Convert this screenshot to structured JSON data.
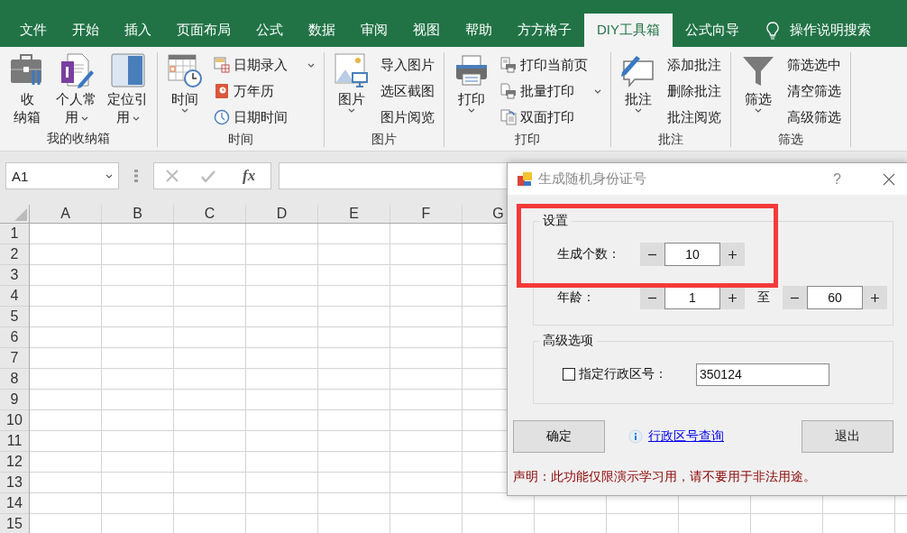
{
  "tabs": [
    {
      "label": "文件",
      "selected": false
    },
    {
      "label": "开始",
      "selected": false
    },
    {
      "label": "插入",
      "selected": false
    },
    {
      "label": "页面布局",
      "selected": false
    },
    {
      "label": "公式",
      "selected": false
    },
    {
      "label": "数据",
      "selected": false
    },
    {
      "label": "审阅",
      "selected": false
    },
    {
      "label": "视图",
      "selected": false
    },
    {
      "label": "帮助",
      "selected": false
    },
    {
      "label": "方方格子",
      "selected": false
    },
    {
      "label": "DIY工具箱",
      "selected": true
    },
    {
      "label": "公式向导",
      "selected": false
    }
  ],
  "search": {
    "label": "操作说明搜索"
  },
  "ribbon": {
    "groups": [
      {
        "label": "我的收纳箱",
        "large": [
          {
            "lines": [
              "收",
              "纳箱"
            ],
            "dropdown": false
          },
          {
            "lines": [
              "个人常",
              "用"
            ],
            "dropdown": true
          },
          {
            "lines": [
              "定位引",
              "用"
            ],
            "dropdown": true
          }
        ]
      },
      {
        "label": "时间",
        "large": [
          {
            "lines": [
              "时间"
            ],
            "dropdown": true
          }
        ],
        "small": [
          {
            "label": "日期录入",
            "dropdown": true
          },
          {
            "label": "万年历",
            "dropdown": false
          },
          {
            "label": "日期时间",
            "dropdown": false
          }
        ]
      },
      {
        "label": "图片",
        "large": [
          {
            "lines": [
              "图片"
            ],
            "dropdown": true
          }
        ],
        "small": [
          {
            "label": "导入图片",
            "dropdown": false
          },
          {
            "label": "选区截图",
            "dropdown": false
          },
          {
            "label": "图片阅览",
            "dropdown": false
          }
        ]
      },
      {
        "label": "打印",
        "large": [
          {
            "lines": [
              "打印"
            ],
            "dropdown": true
          }
        ],
        "small": [
          {
            "label": "打印当前页",
            "dropdown": false
          },
          {
            "label": "批量打印",
            "dropdown": true
          },
          {
            "label": "双面打印",
            "dropdown": false
          }
        ]
      },
      {
        "label": "批注",
        "large": [
          {
            "lines": [
              "批注"
            ],
            "dropdown": true
          }
        ],
        "small": [
          {
            "label": "添加批注",
            "dropdown": false
          },
          {
            "label": "删除批注",
            "dropdown": false
          },
          {
            "label": "批注阅览",
            "dropdown": false
          }
        ]
      },
      {
        "label": "筛选",
        "large": [
          {
            "lines": [
              "筛选"
            ],
            "dropdown": true
          }
        ],
        "small": [
          {
            "label": "筛选选中",
            "dropdown": false
          },
          {
            "label": "清空筛选",
            "dropdown": false
          },
          {
            "label": "高级筛选",
            "dropdown": false
          }
        ]
      }
    ]
  },
  "formula_bar": {
    "name_box": "A1",
    "function_label": "fx"
  },
  "sheet": {
    "columns": [
      "A",
      "B",
      "C",
      "D",
      "E",
      "F",
      "G"
    ],
    "rows": [
      "1",
      "2",
      "3",
      "4",
      "5",
      "6",
      "7",
      "8",
      "9",
      "10",
      "11",
      "12",
      "13",
      "14",
      "15"
    ]
  },
  "dialog": {
    "title": "生成随机身份证号",
    "help": "?",
    "settings": {
      "title": "设置",
      "highlighted": true,
      "count": {
        "label": "生成个数：",
        "value": "10"
      },
      "age": {
        "label": "年龄：",
        "from": "1",
        "separator": "至",
        "to": "60"
      }
    },
    "advanced": {
      "title": "高级选项",
      "checkbox": {
        "label": "指定行政区号：",
        "checked": false
      },
      "region_code": "350124"
    },
    "ok_button": "确定",
    "lookup_link": "行政区号查询",
    "exit_button": "退出",
    "notice": "声明：此功能仅限演示学习用，请不要用于非法用途。"
  }
}
